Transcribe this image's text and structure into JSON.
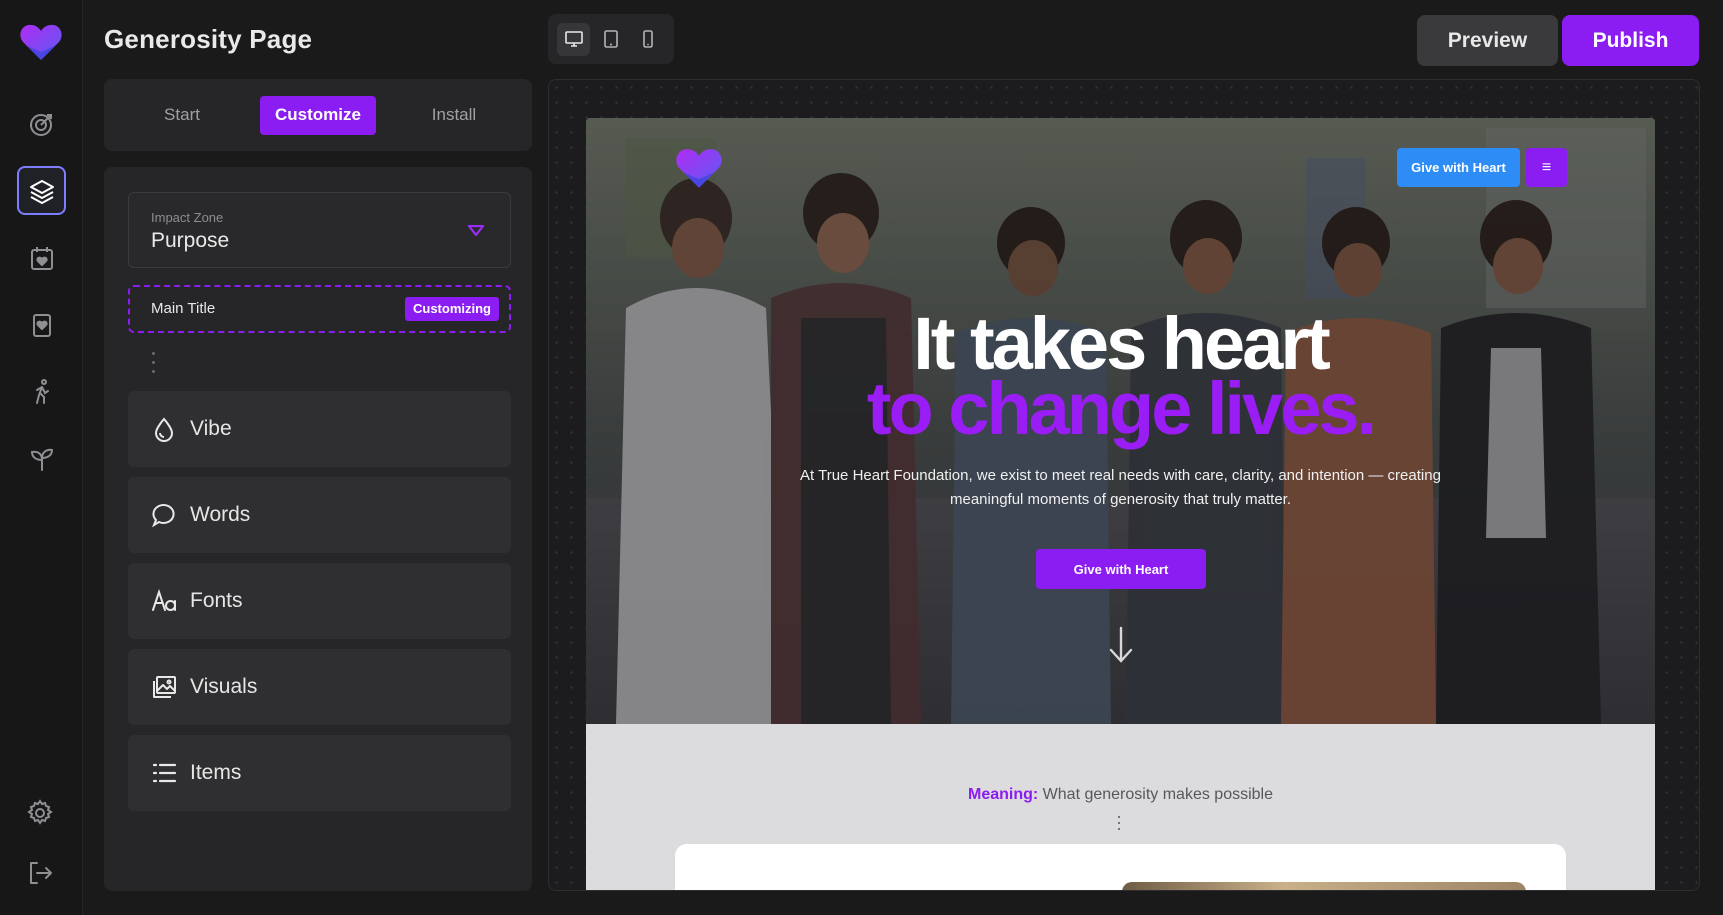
{
  "app": {
    "page_title": "Generosity Page",
    "brand_color": "#8b1df2"
  },
  "rail": {
    "items": [
      {
        "name": "target-icon",
        "active": false
      },
      {
        "name": "layers-icon",
        "active": true
      },
      {
        "name": "calendar-heart-icon",
        "active": false
      },
      {
        "name": "bookmark-heart-icon",
        "active": false
      },
      {
        "name": "person-walk-icon",
        "active": false
      },
      {
        "name": "sprout-icon",
        "active": false
      }
    ],
    "bottom": [
      "gear-icon",
      "logout-icon"
    ]
  },
  "device_switch": {
    "options": [
      "desktop-icon",
      "tablet-icon",
      "mobile-icon"
    ],
    "selected": "desktop-icon"
  },
  "toolbar": {
    "preview_label": "Preview",
    "publish_label": "Publish"
  },
  "tabs": [
    {
      "label": "Start",
      "active": false
    },
    {
      "label": "Customize",
      "active": true
    },
    {
      "label": "Install",
      "active": false
    }
  ],
  "panel": {
    "zone": {
      "label": "Impact Zone",
      "value": "Purpose"
    },
    "main_title": {
      "label": "Main Title",
      "badge": "Customizing"
    },
    "items": [
      {
        "label": "Vibe",
        "icon": "drop-icon"
      },
      {
        "label": "Words",
        "icon": "speech-bubble-icon"
      },
      {
        "label": "Fonts",
        "icon": "font-aa-icon"
      },
      {
        "label": "Visuals",
        "icon": "images-icon"
      },
      {
        "label": "Items",
        "icon": "list-icon"
      }
    ]
  },
  "site": {
    "give_top_label": "Give with Heart",
    "menu_glyph": "≡",
    "headline_line1": "It takes heart",
    "headline_line2": "to change lives.",
    "subtext": "At True Heart Foundation, we exist to meet real needs with care, clarity, and intention — creating meaningful moments of generosity that truly matter.",
    "give_mid_label": "Give with Heart",
    "meaning_accent": "Meaning:",
    "meaning_text": " What generosity makes possible",
    "give_top_color": "#2d8cf5",
    "headline_accent_color": "#9a1df5"
  }
}
